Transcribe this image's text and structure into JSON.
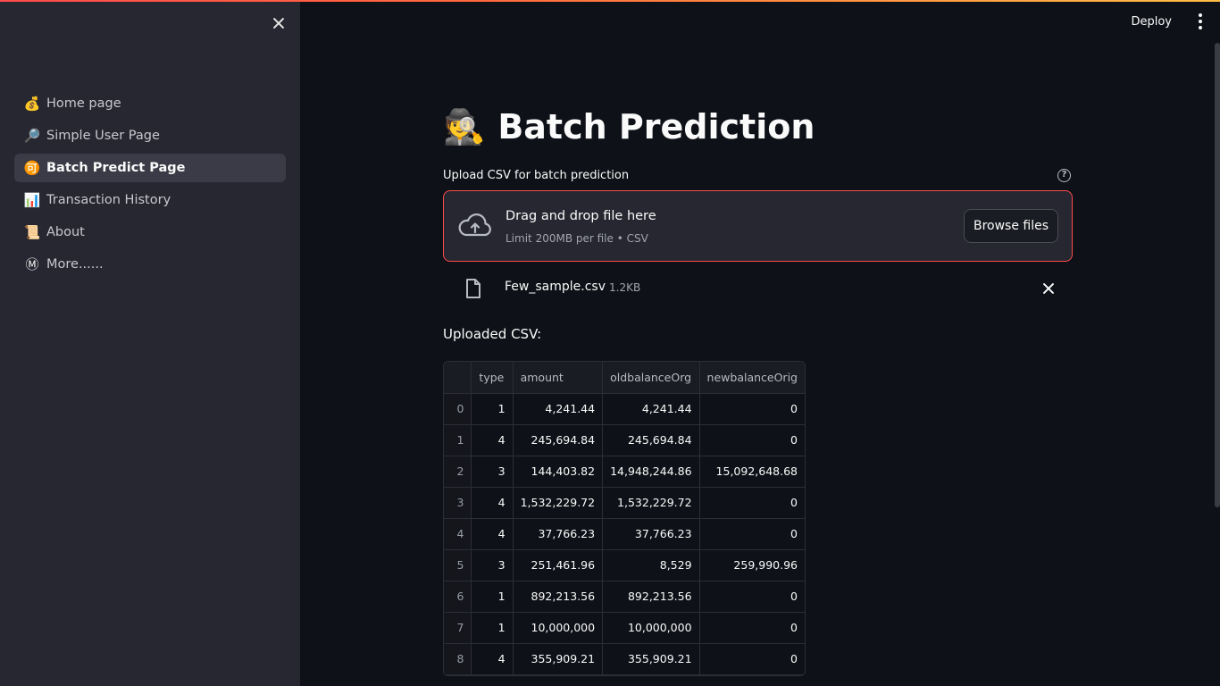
{
  "header": {
    "deploy_label": "Deploy"
  },
  "sidebar": {
    "items": [
      {
        "icon": "💰",
        "icon_name": "money-bag-icon",
        "label": "Home page",
        "active": false
      },
      {
        "icon": "🔎",
        "icon_name": "magnifier-icon",
        "label": "Simple User Page",
        "active": false
      },
      {
        "icon": "🉑",
        "icon_name": "batch-icon",
        "label": "Batch Predict Page",
        "active": true
      },
      {
        "icon": "📊",
        "icon_name": "bar-chart-icon",
        "label": "Transaction History",
        "active": false
      },
      {
        "icon": "📜",
        "icon_name": "scroll-icon",
        "label": "About",
        "active": false
      },
      {
        "icon": "Ⓜ",
        "icon_name": "circled-m-icon",
        "label": "More......",
        "active": false
      }
    ]
  },
  "main": {
    "title_icon": "🕵️",
    "title": "Batch Prediction",
    "uploader": {
      "label": "Upload CSV for batch prediction",
      "help_icon": "?",
      "drop_title": "Drag and drop file here",
      "drop_subtitle": "Limit 200MB per file • CSV",
      "browse_label": "Browse files"
    },
    "uploaded_file": {
      "name": "Few_sample.csv",
      "size": "1.2KB"
    },
    "section_label": "Uploaded CSV:",
    "table": {
      "columns": [
        "",
        "type",
        "amount",
        "oldbalanceOrg",
        "newbalanceOrig"
      ],
      "rows": [
        [
          "0",
          "1",
          "4,241.44",
          "4,241.44",
          "0"
        ],
        [
          "1",
          "4",
          "245,694.84",
          "245,694.84",
          "0"
        ],
        [
          "2",
          "3",
          "144,403.82",
          "14,948,244.86",
          "15,092,648.68"
        ],
        [
          "3",
          "4",
          "1,532,229.72",
          "1,532,229.72",
          "0"
        ],
        [
          "4",
          "4",
          "37,766.23",
          "37,766.23",
          "0"
        ],
        [
          "5",
          "3",
          "251,461.96",
          "8,529",
          "259,990.96"
        ],
        [
          "6",
          "1",
          "892,213.56",
          "892,213.56",
          "0"
        ],
        [
          "7",
          "1",
          "10,000,000",
          "10,000,000",
          "0"
        ],
        [
          "8",
          "4",
          "355,909.21",
          "355,909.21",
          "0"
        ]
      ]
    }
  },
  "colors": {
    "accent": "#ff4b4b",
    "background": "#0e1117",
    "sidebar": "#262730"
  }
}
